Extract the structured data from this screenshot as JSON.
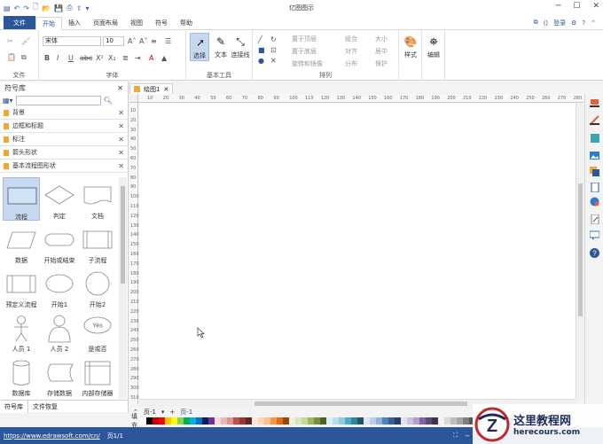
{
  "window": {
    "title": "亿图图示"
  },
  "tabs": {
    "file": "文件",
    "items": [
      "开始",
      "插入",
      "页面布局",
      "视图",
      "符号",
      "帮助"
    ],
    "active_index": 0,
    "login": "登录"
  },
  "ribbon": {
    "file_group": {
      "label": "文件"
    },
    "font_group": {
      "label": "字体",
      "font_name": "宋体",
      "font_size": "10"
    },
    "tools_group": {
      "label": "基本工具",
      "select": "选择",
      "text": "文本",
      "connector": "连接线"
    },
    "arrange_group": {
      "label": "排列",
      "items": [
        "置于顶层",
        "置于底层",
        "旋转和镜像",
        "组合",
        "对齐",
        "分布",
        "大小",
        "居中",
        "保护"
      ]
    },
    "style": "样式",
    "edit": "编辑"
  },
  "library": {
    "title": "符号库",
    "categories": [
      "背景",
      "边框和标题",
      "标注",
      "箭头形状",
      "基本流程图形状"
    ],
    "shapes": [
      "流程",
      "判定",
      "文档",
      "数据",
      "开始或结束",
      "子流程",
      "预定义流程",
      "开始1",
      "开始2",
      "人员 1",
      "人员 2",
      "是或否",
      "数据库",
      "存储数据",
      "内部存储器"
    ],
    "yes_text": "Yes",
    "bottom_tabs": [
      "符号库",
      "文件恢复"
    ]
  },
  "document": {
    "tab_name": "绘图1",
    "ruler_h": [
      "10",
      "20",
      "30",
      "40",
      "50",
      "60",
      "70",
      "80",
      "90",
      "100",
      "110",
      "120",
      "130",
      "140",
      "150",
      "160",
      "170",
      "180",
      "190",
      "200",
      "210",
      "220",
      "230",
      "240",
      "250",
      "260",
      "270",
      "280"
    ],
    "ruler_v": [
      "10",
      "20",
      "30",
      "40",
      "50",
      "60",
      "70",
      "80",
      "90",
      "100",
      "110",
      "120",
      "130",
      "140",
      "150",
      "160",
      "170",
      "180",
      "190",
      "200",
      "210",
      "220",
      "230",
      "240",
      "250",
      "260",
      "270",
      "280",
      "290",
      "300",
      "310"
    ]
  },
  "pagebar": {
    "page_left": "页-1",
    "page_tab": "页-1"
  },
  "colorbar": {
    "label": "填充",
    "swatches": [
      "#ffffff",
      "#000000",
      "#c00000",
      "#ff0000",
      "#ffc000",
      "#ffff00",
      "#92d050",
      "#00b050",
      "#00b0f0",
      "#0070c0",
      "#002060",
      "#7030a0",
      "#f2dcdb",
      "#e6b9b8",
      "#d99694",
      "#c0504d",
      "#953735",
      "#632523",
      "#fde9d9",
      "#fbd5b5",
      "#fac08f",
      "#f79646",
      "#e46c0a",
      "#984807",
      "#ebf1dd",
      "#d7e4bc",
      "#c3d69b",
      "#9bbb59",
      "#76923c",
      "#4f6128",
      "#dbeef3",
      "#b7dde8",
      "#92cddc",
      "#4bacc6",
      "#31859b",
      "#205867",
      "#dce6f2",
      "#b9cde5",
      "#95b3d7",
      "#4f81bd",
      "#376092",
      "#254061",
      "#e5e0ec",
      "#ccc1da",
      "#b3a2c7",
      "#8064a2",
      "#604a7b",
      "#403151",
      "#f2f2f2",
      "#d9d9d9",
      "#bfbfbf",
      "#a6a6a6",
      "#7f7f7f",
      "#595959",
      "#1f497d",
      "#c6d9f1",
      "#8db3e2",
      "#548dd4",
      "#17365d",
      "#0f243e"
    ]
  },
  "status": {
    "url": "https://www.edrawsoft.com/cn/",
    "page": "页1/1"
  },
  "watermark": {
    "cn": "这里教程网",
    "en": "herecours.com"
  }
}
